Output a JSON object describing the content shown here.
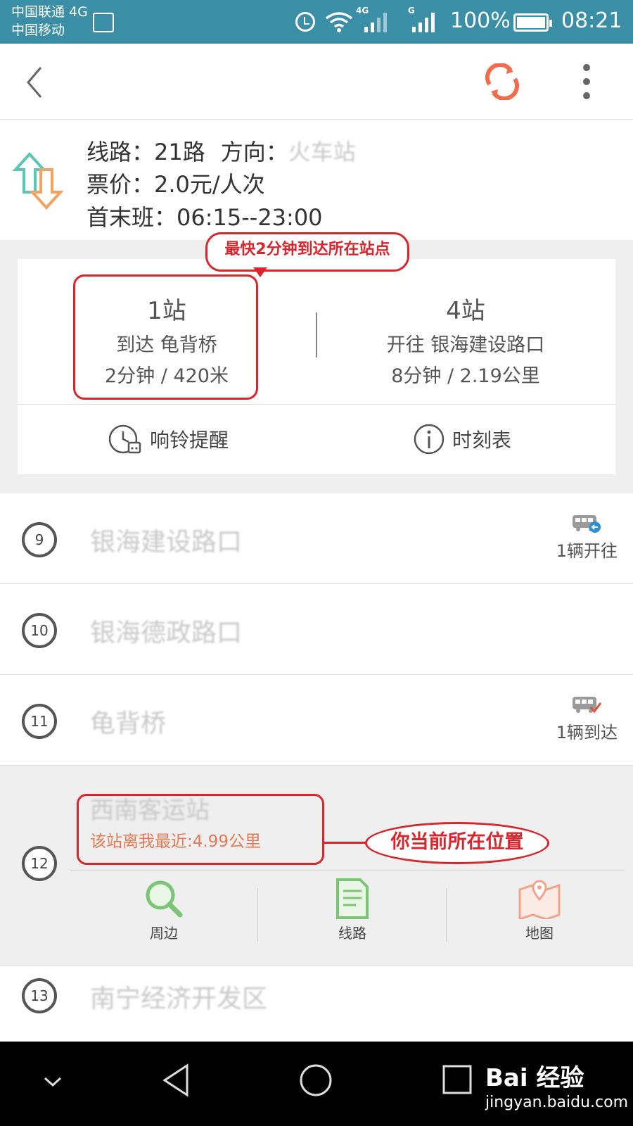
{
  "status_bar": {
    "carrier_1": "中国联通 4G",
    "carrier_2": "中国移动",
    "net_1": "4G",
    "net_2": "G",
    "battery": "100%",
    "time": "08:21"
  },
  "app_bar": {
    "icons": [
      "back-icon",
      "refresh-icon",
      "more-icon"
    ],
    "accent_color": "#f26b4a"
  },
  "route": {
    "line_label": "线路：21路",
    "direction_label": "方向：",
    "direction_value": "火车站",
    "fare": "票价：2.0元/人次",
    "schedule": "首末班：06:15--23:00"
  },
  "arrival": {
    "nearest_stops": "1站",
    "nearest_to": "到达 龟背桥",
    "nearest_eta": "2分钟 / 420米",
    "next_stops": "4站",
    "next_to": "开往 银海建设路口",
    "next_eta": "8分钟 / 2.19公里",
    "ring_reminder": "响铃提醒",
    "timetable": "时刻表"
  },
  "annotations": {
    "fastest": "最快2分钟到达所在站点",
    "current_position": "你当前所在位置",
    "color": "#d9262d"
  },
  "stations": [
    {
      "num": "9",
      "name": "银海建设路口",
      "bus": "1辆开往"
    },
    {
      "num": "10",
      "name": "银海德政路口",
      "bus": ""
    },
    {
      "num": "11",
      "name": "龟背桥",
      "bus": "1辆到达"
    }
  ],
  "current_station": {
    "num": "12",
    "name": "西南客运站",
    "distance": "该站离我最近:4.99公里",
    "actions": [
      "周边",
      "线路",
      "地图"
    ]
  },
  "next_station": {
    "num": "13",
    "name": "南宁经济开发区"
  },
  "watermark": {
    "logo": "Bai 经验",
    "url": "jingyan.baidu.com"
  }
}
